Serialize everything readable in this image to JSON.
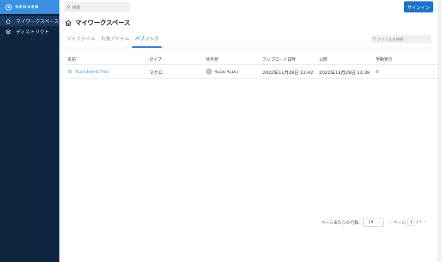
{
  "sidebar": {
    "brand": "SERVER",
    "items": [
      {
        "label": "マイワークスペース",
        "icon": "home-icon"
      },
      {
        "label": "ディストリクト",
        "icon": "district-icon"
      }
    ]
  },
  "header": {
    "search_placeholder": "検索",
    "signin_label": "サインイン"
  },
  "page": {
    "title": "マイワークスペース",
    "tabs": [
      "マイファイル",
      "共有アイテム",
      "パブリック"
    ],
    "active_tab": "パブリック",
    "file_search_placeholder": "ファイルを検索"
  },
  "table": {
    "columns": [
      "名前",
      "タイプ",
      "所有者",
      "アップロード日時",
      "公開",
      "手動実行"
    ],
    "rows": [
      {
        "name": "TransformCTSV",
        "type": "マクロ",
        "owner": "Suzu Suzu",
        "uploaded": "2022年11月28日 13:42",
        "published": "2022年11月29日 13:38",
        "manual_runs": "0"
      }
    ]
  },
  "pagination": {
    "rows_per_page_label": "ページあたりの行数:",
    "rows_per_page": "10",
    "prev": "‹",
    "page_label": "ページ",
    "current_page": "1",
    "total": "/ 1",
    "next": "›"
  },
  "colors": {
    "sidebar_bg": "#10253f",
    "brand_bg": "#3b8fe0",
    "accent": "#1f6fc5",
    "signin_bg": "#1a73c9"
  }
}
